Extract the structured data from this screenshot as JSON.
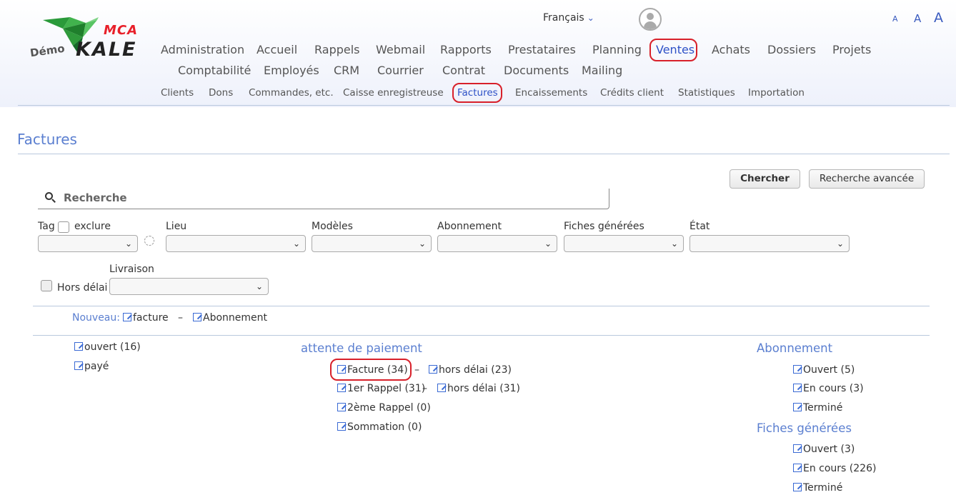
{
  "logo": {
    "mca": "MCA",
    "kale": "KALE",
    "demo": "Démo"
  },
  "header": {
    "language": "Français",
    "font_sizes": [
      "A",
      "A",
      "A"
    ]
  },
  "nav": {
    "row1": [
      "Administration",
      "Accueil",
      "Rappels",
      "Webmail",
      "Rapports",
      "Prestataires",
      "Planning",
      "Ventes",
      "Achats",
      "Dossiers",
      "Projets"
    ],
    "row2": [
      "Comptabilité",
      "Employés",
      "CRM",
      "Courrier",
      "Contrat",
      "Documents",
      "Mailing"
    ],
    "active": "Ventes"
  },
  "subnav": {
    "items": [
      "Clients",
      "Dons",
      "Commandes, etc.",
      "Caisse enregistreuse",
      "Factures",
      "Encaissements",
      "Crédits client",
      "Statistiques",
      "Importation"
    ],
    "active": "Factures"
  },
  "page": {
    "title": "Factures"
  },
  "search": {
    "placeholder": "Recherche",
    "search_button": "Chercher",
    "advanced_button": "Recherche avancée"
  },
  "filters": {
    "tag_label": "Tag",
    "exclude_label": "exclure",
    "lieu": "Lieu",
    "modeles": "Modèles",
    "abonnement": "Abonnement",
    "fiches": "Fiches générées",
    "etat": "État",
    "hors_delai": "Hors délai",
    "livraison": "Livraison"
  },
  "nouveau": {
    "label": "Nouveau:",
    "facture": "facture",
    "sep": "–",
    "abonnement": "Abonnement"
  },
  "left_links": [
    "ouvert (16)",
    "payé"
  ],
  "attente": {
    "title": "attente de paiement",
    "rows": [
      {
        "main": "Facture (34)",
        "sep": "–",
        "late": "hors délai (23)"
      },
      {
        "main": "1er Rappel (31)",
        "sep": "–",
        "late": "hors délai (31)"
      },
      {
        "main": "2ème Rappel (0)"
      },
      {
        "main": "Sommation (0)"
      }
    ]
  },
  "abonnement_section": {
    "title": "Abonnement",
    "items": [
      "Ouvert (5)",
      "En cours (3)",
      "Terminé"
    ]
  },
  "fiches_section": {
    "title": "Fiches générées",
    "items": [
      "Ouvert (3)",
      "En cours (226)",
      "Terminé"
    ]
  },
  "colors": {
    "accent": "#2e51c7",
    "title": "#5b7fd0",
    "highlight": "#d8202a"
  }
}
